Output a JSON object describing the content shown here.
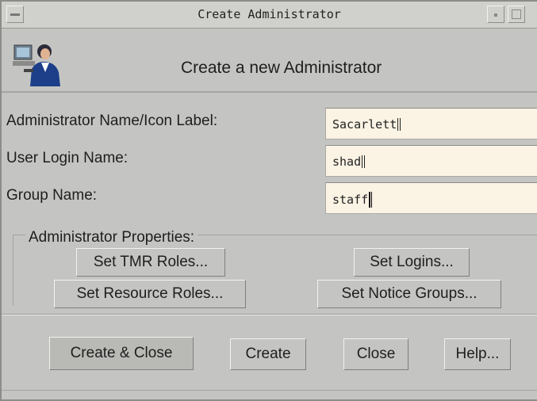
{
  "window": {
    "title": "Create Administrator"
  },
  "header": {
    "title": "Create a new Administrator",
    "icon": "administrator-user-icon"
  },
  "form": {
    "admin_name": {
      "label": "Administrator Name/Icon Label:",
      "value": "Sacarlett"
    },
    "login_name": {
      "label": "User Login Name:",
      "value": "shad"
    },
    "group_name": {
      "label": "Group Name:",
      "value": "staff"
    }
  },
  "properties": {
    "legend": "Administrator Properties:",
    "set_tmr_roles": "Set TMR Roles...",
    "set_logins": "Set Logins...",
    "set_resource_roles": "Set Resource Roles...",
    "set_notice_groups": "Set Notice Groups..."
  },
  "actions": {
    "create_close": "Create & Close",
    "create": "Create",
    "close": "Close",
    "help": "Help..."
  }
}
